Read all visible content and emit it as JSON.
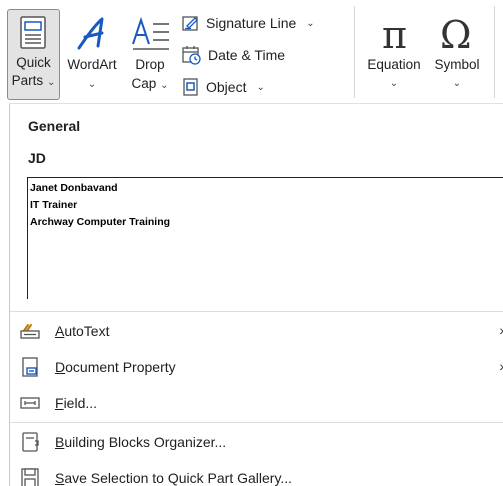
{
  "ribbon": {
    "quick_parts": {
      "line1": "Quick",
      "line2": "Parts",
      "chevron": "⌄",
      "icon": "quick-parts-icon"
    },
    "wordart": {
      "line1": "WordArt",
      "chevron": "⌄",
      "icon": "wordart-icon"
    },
    "drop_cap": {
      "line1": "Drop",
      "line2": "Cap",
      "chevron": "⌄",
      "icon": "drop-cap-icon"
    },
    "signature_line": {
      "label": "Signature Line",
      "chevron": "⌄",
      "icon": "signature-line-icon"
    },
    "date_time": {
      "label": "Date & Time",
      "icon": "calendar-clock-icon"
    },
    "object": {
      "label": "Object",
      "chevron": "⌄",
      "icon": "object-icon"
    },
    "equation": {
      "line1": "Equation",
      "chevron": "⌄",
      "glyph": "π"
    },
    "symbol": {
      "line1": "Symbol",
      "chevron": "⌄",
      "glyph": "Ω"
    }
  },
  "panel": {
    "section_title": "General",
    "entry_name": "JD",
    "preview_lines": [
      "Janet Donbavand",
      "IT Trainer",
      "Archway Computer Training"
    ]
  },
  "menu": {
    "autotext": {
      "underline": "A",
      "rest": "utoText",
      "arrow": "›"
    },
    "document_property": {
      "underline": "D",
      "rest": "ocument Property",
      "arrow": "›"
    },
    "field": {
      "underline": "F",
      "rest": "ield..."
    },
    "building_blocks": {
      "underline": "B",
      "rest": "uilding Blocks Organizer..."
    },
    "save_selection": {
      "underline": "S",
      "rest": "ave Selection to Quick Part Gallery..."
    }
  },
  "colors": {
    "accent_blue": "#185abd",
    "icon_gray": "#555555",
    "selected_bg": "#e3e3e3"
  }
}
